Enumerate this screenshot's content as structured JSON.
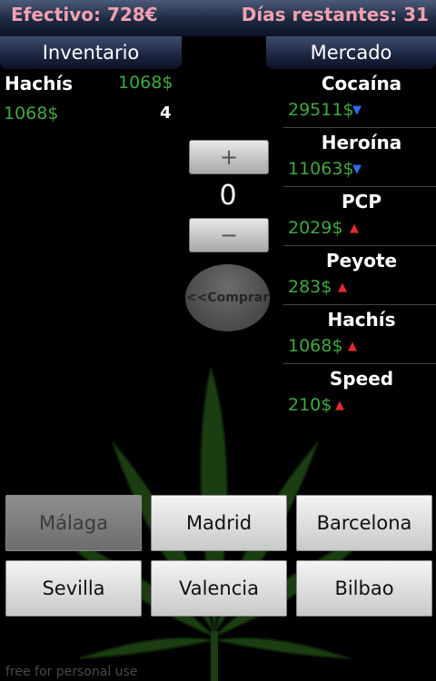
{
  "status": {
    "cash": "Efectivo: 728€",
    "days_left": "Días restantes: 31"
  },
  "tabs": {
    "inventory": "Inventario",
    "market": "Mercado"
  },
  "inventory": {
    "item_name": "Hachís",
    "market_price": "1068$",
    "paid_price": "1068$",
    "quantity": "4"
  },
  "trade": {
    "plus_label": "+",
    "quantity": "0",
    "minus_label": "−",
    "buy_label": "<<Comprar"
  },
  "market": {
    "items": [
      {
        "name": "Cocaína",
        "price": "29511$",
        "trend": "▼"
      },
      {
        "name": "Heroína",
        "price": "11063$",
        "trend": "▼"
      },
      {
        "name": "PCP",
        "price": "2029$",
        "trend": "▲"
      },
      {
        "name": "Peyote",
        "price": "283$",
        "trend": "▲"
      },
      {
        "name": "Hachís",
        "price": "1068$",
        "trend": "▲"
      },
      {
        "name": "Speed",
        "price": "210$",
        "trend": "▲"
      }
    ]
  },
  "cities": [
    "Málaga",
    "Madrid",
    "Barcelona",
    "Sevilla",
    "Valencia",
    "Bilbao"
  ],
  "footer": "free for personal use",
  "colors": {
    "price_green": "#3fa93f",
    "trend_down": "#2e6be6",
    "trend_up": "#e32b2b",
    "header_text": "#f2a0b0"
  }
}
